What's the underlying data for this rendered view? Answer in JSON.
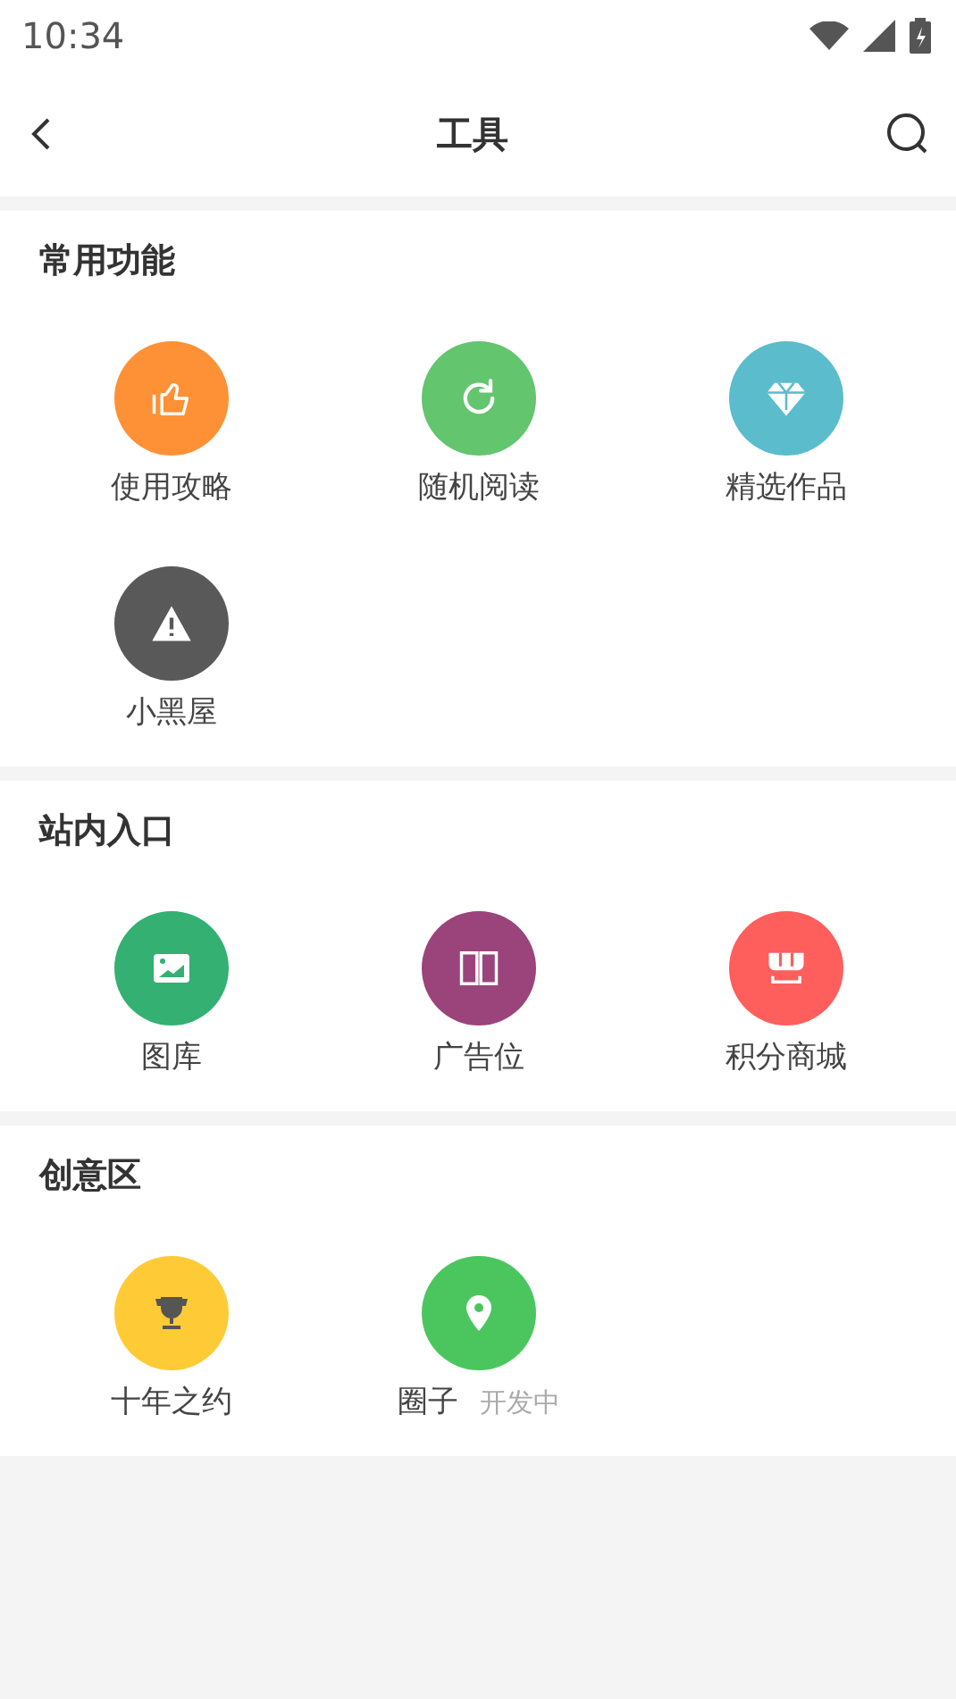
{
  "status_bar": {
    "time": "10:34"
  },
  "header": {
    "title": "工具"
  },
  "sections": [
    {
      "title": "常用功能",
      "items": [
        {
          "label": "使用攻略",
          "color": "#fe9135"
        },
        {
          "label": "随机阅读",
          "color": "#63c56e"
        },
        {
          "label": "精选作品",
          "color": "#5bbccc"
        },
        {
          "label": "小黑屋",
          "color": "#595959"
        }
      ]
    },
    {
      "title": "站内入口",
      "items": [
        {
          "label": "图库",
          "color": "#33b072"
        },
        {
          "label": "广告位",
          "color": "#9a447b"
        },
        {
          "label": "积分商城",
          "color": "#fe5e5c"
        }
      ]
    },
    {
      "title": "创意区",
      "items": [
        {
          "label": "十年之约",
          "color": "#fecb37"
        },
        {
          "label": "圈子",
          "color": "#4bc65f",
          "tag": "开发中"
        }
      ]
    }
  ]
}
